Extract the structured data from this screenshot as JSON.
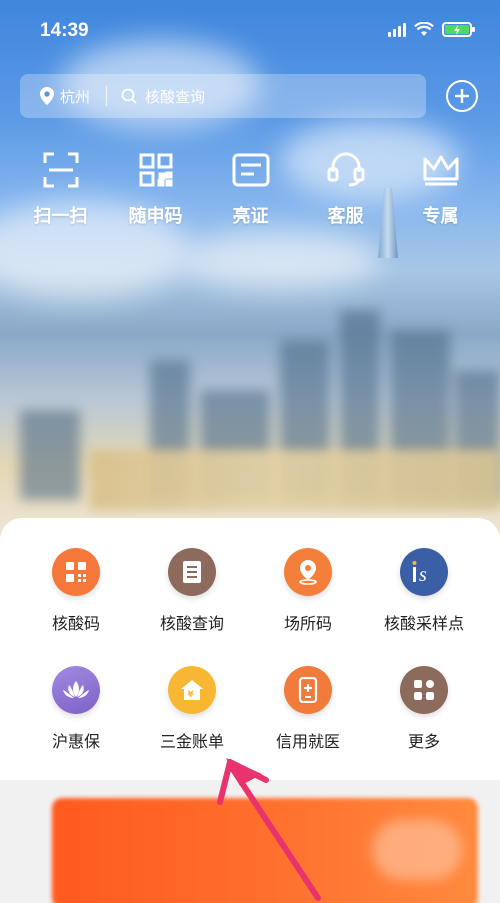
{
  "status_bar": {
    "time": "14:39"
  },
  "search": {
    "city": "杭州",
    "placeholder": "核酸查询"
  },
  "quick_actions": [
    {
      "label": "扫一扫",
      "icon": "scan-icon"
    },
    {
      "label": "随申码",
      "icon": "qr-code-icon"
    },
    {
      "label": "亮证",
      "icon": "id-card-icon"
    },
    {
      "label": "客服",
      "icon": "headset-icon"
    },
    {
      "label": "专属",
      "icon": "crown-icon"
    }
  ],
  "services": [
    {
      "label": "核酸码",
      "icon": "qr-code-icon",
      "color": "#f5783a"
    },
    {
      "label": "核酸查询",
      "icon": "document-list-icon",
      "color": "#8d6a5b"
    },
    {
      "label": "场所码",
      "icon": "location-pin-icon",
      "color": "#f37f3b"
    },
    {
      "label": "核酸采样点",
      "icon": "sampling-point-icon",
      "color": "#3b5fa6"
    },
    {
      "label": "沪惠保",
      "icon": "lotus-icon",
      "color": "#8b6fd1"
    },
    {
      "label": "三金账单",
      "icon": "house-yen-icon",
      "color": "#f7b733"
    },
    {
      "label": "信用就医",
      "icon": "medical-phone-icon",
      "color": "#f07b3a"
    },
    {
      "label": "更多",
      "icon": "more-grid-icon",
      "color": "#8c6a5c"
    }
  ],
  "colors": {
    "accent_pink": "#e8336d",
    "banner_orange": "#ff5a1f"
  }
}
